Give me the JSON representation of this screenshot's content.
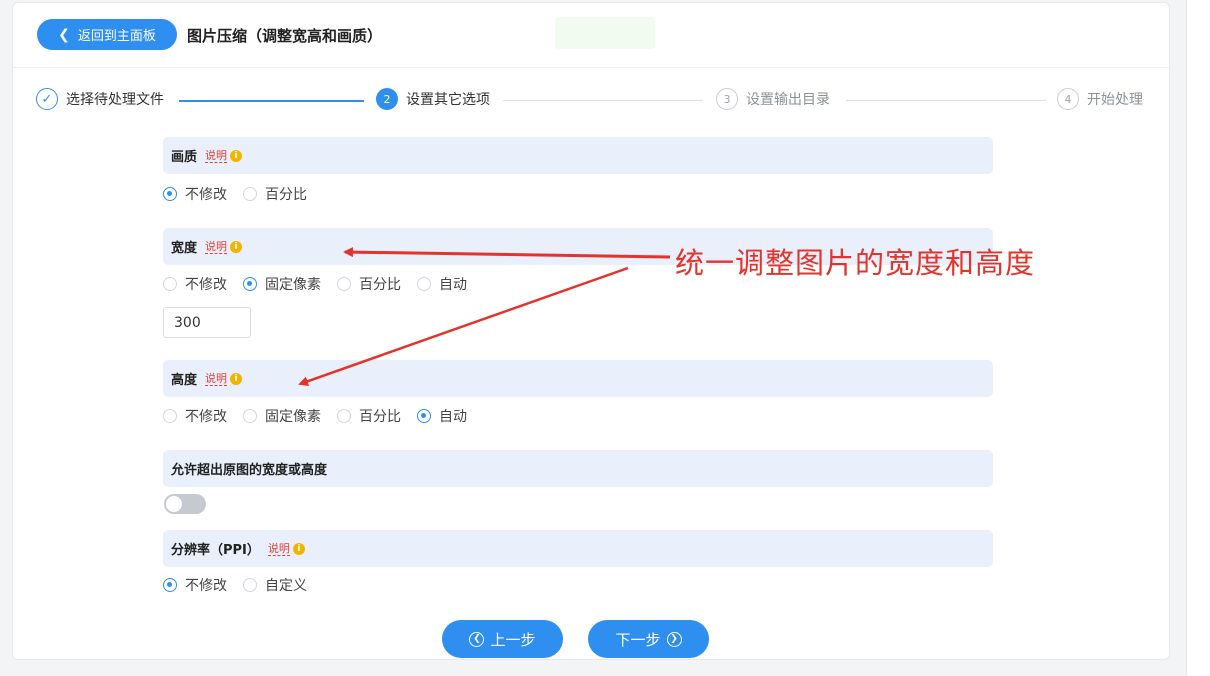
{
  "header": {
    "back_label": "返回到主面板",
    "title": "图片压缩（调整宽高和画质）"
  },
  "steps": [
    {
      "num": "1",
      "label": "选择待处理文件",
      "state": "done"
    },
    {
      "num": "2",
      "label": "设置其它选项",
      "state": "active"
    },
    {
      "num": "3",
      "label": "设置输出目录",
      "state": "todo"
    },
    {
      "num": "4",
      "label": "开始处理",
      "state": "todo"
    }
  ],
  "help_label": "说明",
  "sections": {
    "quality": {
      "title": "画质",
      "options": [
        "不修改",
        "百分比"
      ],
      "selected": "不修改"
    },
    "width": {
      "title": "宽度",
      "options": [
        "不修改",
        "固定像素",
        "百分比",
        "自动"
      ],
      "selected": "固定像素",
      "value": "300"
    },
    "height": {
      "title": "高度",
      "options": [
        "不修改",
        "固定像素",
        "百分比",
        "自动"
      ],
      "selected": "自动"
    },
    "allow_exceed": {
      "title": "允许超出原图的宽度或高度",
      "enabled": false
    },
    "resolution": {
      "title": "分辨率（PPI）",
      "options": [
        "不修改",
        "自定义"
      ],
      "selected": "不修改"
    }
  },
  "nav": {
    "prev": "上一步",
    "next": "下一步"
  },
  "annotation": {
    "text": "统一调整图片的宽度和高度",
    "color": "#e4332b"
  },
  "colors": {
    "accent": "#2f8ff0",
    "section_bg": "#e9f0fb"
  }
}
